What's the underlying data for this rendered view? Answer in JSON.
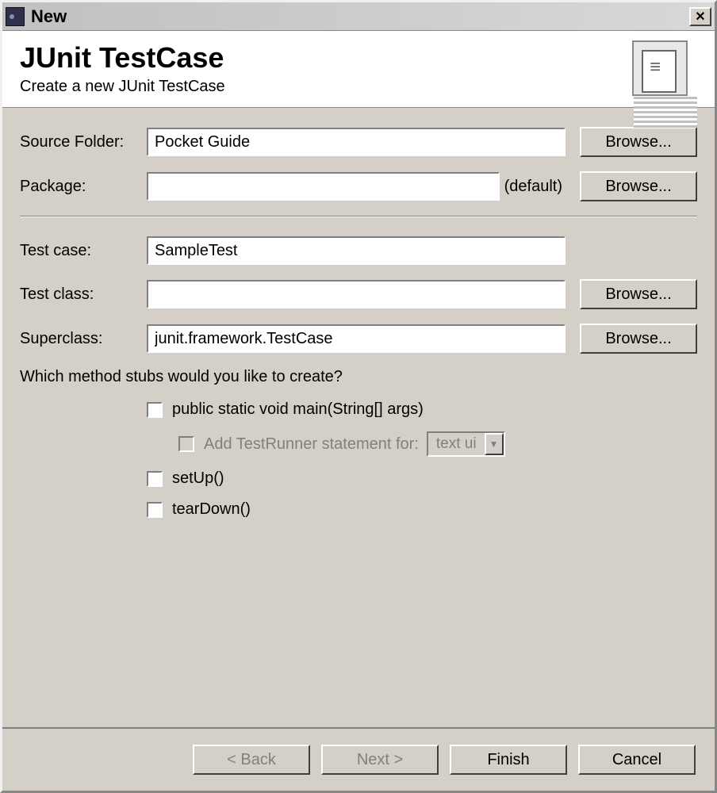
{
  "titlebar": {
    "title": "New"
  },
  "banner": {
    "title": "JUnit TestCase",
    "subtitle": "Create a new JUnit TestCase"
  },
  "labels": {
    "sourceFolder": "Source Folder:",
    "package": "Package:",
    "packageSuffix": "(default)",
    "testCase": "Test case:",
    "testClass": "Test class:",
    "superclass": "Superclass:",
    "question": "Which method stubs would you like to create?",
    "mainCheck": "public static void main(String[] args)",
    "testRunnerCheck": "Add TestRunner statement for:",
    "setupCheck": "setUp()",
    "teardownCheck": "tearDown()",
    "comboValue": "text ui"
  },
  "values": {
    "sourceFolder": "Pocket Guide",
    "package": "",
    "testCase": "SampleTest",
    "testClass": "",
    "superclass": "junit.framework.TestCase"
  },
  "buttons": {
    "browse": "Browse...",
    "back": "< Back",
    "next": "Next >",
    "finish": "Finish",
    "cancel": "Cancel"
  }
}
